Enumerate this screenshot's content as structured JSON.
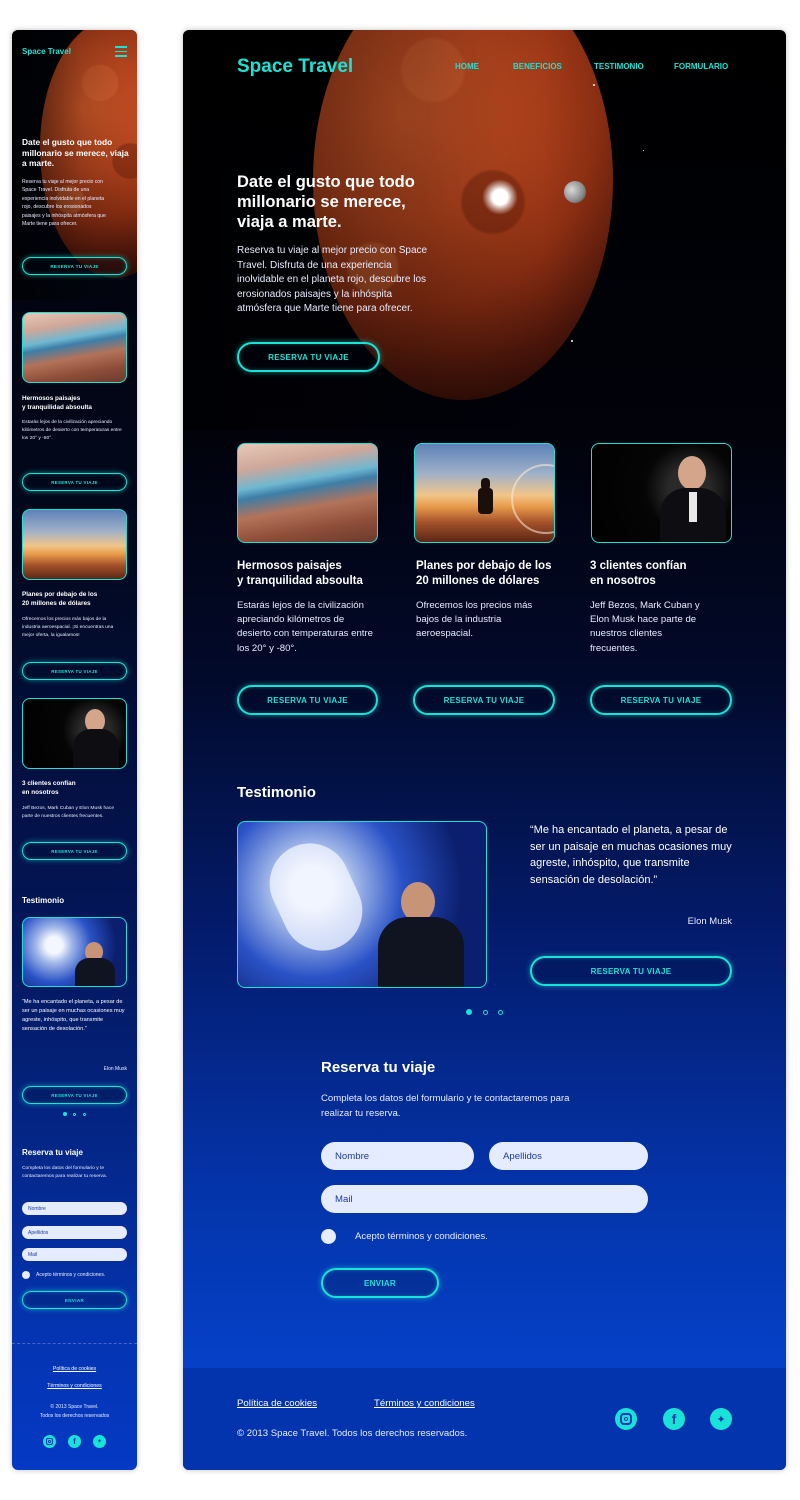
{
  "brand": "Space Travel",
  "nav": {
    "items": [
      "HOME",
      "BENEFICIOS",
      "TESTIMONIO",
      "FORMULARIO"
    ]
  },
  "hero": {
    "title": "Date el gusto que todo millonario se merece, viaja a marte.",
    "text": "Reserva tu viaje al mejor precio con Space Travel. Disfruta de una experiencia inolvidable en el planeta rojo, descubre los erosionados paisajes y la inhóspita atmósfera que Marte tiene para ofrecer.",
    "cta": "RESERVA TU VIAJE"
  },
  "benefits": [
    {
      "title_l1": "Hermosos paisajes",
      "title_l2": "y tranquilidad absoulta",
      "text": "Estarás lejos de la civilización apreciando kilómetros de desierto con temperaturas entre los 20° y -80°.",
      "cta": "RESERVA TU VIAJE",
      "image": "mars-landscape"
    },
    {
      "title_l1": "Planes por debajo de los",
      "title_l2": "20 millones de dólares",
      "text": "Ofrecemos los precios más bajos de la industria aeroespacial.",
      "mobile_text": "Ofrecemos los precios más bajos de la industria aeroespacial. ¡Si encuentras una mejor oferta, la igualamos!",
      "cta": "RESERVA TU VIAJE",
      "image": "astronaut"
    },
    {
      "title_l1": "3 clientes confían",
      "title_l2": "en nosotros",
      "text": "Jeff Bezos, Mark Cuban y Elon Musk hace parte de nuestros clientes frecuentes.",
      "cta": "RESERVA TU VIAJE",
      "image": "elon-portrait"
    }
  ],
  "testimonial": {
    "heading": "Testimonio",
    "quote": "“Me ha encantado el planeta, a pesar de ser un paisaje en muchas ocasiones muy agreste, inhóspito, que transmite sensación de desolación.”",
    "author": "Elon Musk",
    "cta": "RESERVA TU VIAJE",
    "active_slide": 1,
    "slides": 3
  },
  "form": {
    "heading": "Reserva tu viaje",
    "intro": "Completa los datos del formulario y te contactaremos para realizar tu reserva.",
    "nombre_placeholder": "Nombre",
    "apellidos_placeholder": "Apellidos",
    "mail_placeholder": "Mail",
    "terms_label": "Acepto términos y condiciones.",
    "submit": "ENVIAR"
  },
  "footer": {
    "cookies": "Política de cookies",
    "terms": "Términos y condiciones",
    "copyright": "© 2013 Space Travel. Todos los derechos reservados.",
    "mobile_copyright_l1": "© 2013 Space Travel.",
    "mobile_copyright_l2": "Todos los derechos reservados",
    "social": [
      "instagram-icon",
      "facebook-icon",
      "twitter-icon"
    ]
  },
  "colors": {
    "accent": "#19e3d6",
    "deep_blue": "#0537b8",
    "input_bg": "#e6ecff"
  }
}
